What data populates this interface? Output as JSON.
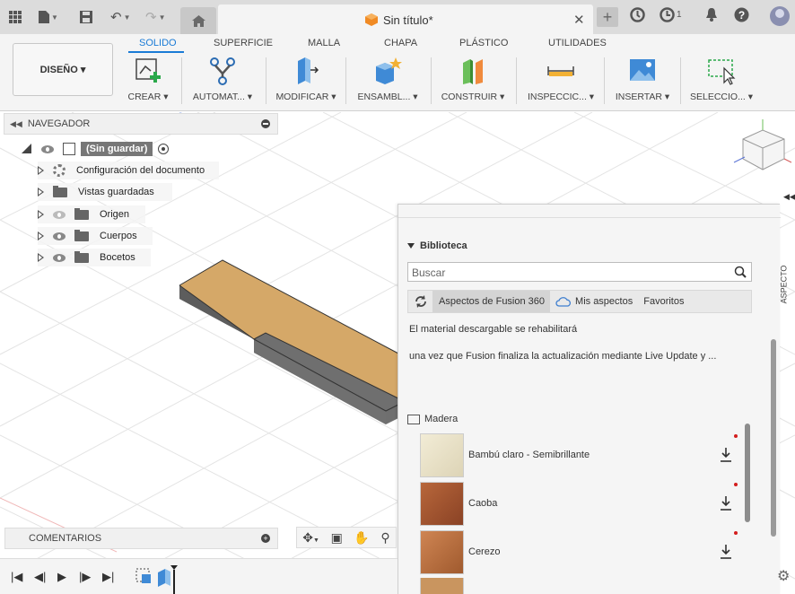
{
  "titlebar": {
    "doc_title": "Sin título*",
    "jobs_count": "1"
  },
  "ribbon": {
    "workspace": "DISEÑO ▾",
    "tabs": [
      {
        "label": "SOLIDO",
        "active": true
      },
      {
        "label": "SUPERFICIE"
      },
      {
        "label": "MALLA"
      },
      {
        "label": "CHAPA"
      },
      {
        "label": "PLÁSTICO"
      },
      {
        "label": "UTILIDADES"
      }
    ],
    "groups": [
      {
        "label": "CREAR ▾",
        "icon": "create-sketch-icon"
      },
      {
        "label": "AUTOMAT... ▾",
        "icon": "automate-icon"
      },
      {
        "label": "MODIFICAR ▾",
        "icon": "modify-icon"
      },
      {
        "label": "ENSAMBL... ▾",
        "icon": "assemble-icon"
      },
      {
        "label": "CONSTRUIR ▾",
        "icon": "construct-icon"
      },
      {
        "label": "INSPECCIC... ▾",
        "icon": "inspect-icon"
      },
      {
        "label": "INSERTAR ▾",
        "icon": "insert-image-icon"
      },
      {
        "label": "SELECCIO... ▾",
        "icon": "select-icon"
      }
    ]
  },
  "navigator": {
    "title": "NAVEGADOR",
    "root": "(Sin guardar)",
    "items": [
      {
        "label": "Configuración del documento",
        "icon": "gear-icon"
      },
      {
        "label": "Vistas guardadas",
        "icon": "folder-icon"
      },
      {
        "label": "Origen",
        "icon": "folder-icon"
      },
      {
        "label": "Cuerpos",
        "icon": "folder-icon"
      },
      {
        "label": "Bocetos",
        "icon": "folder-icon"
      }
    ]
  },
  "panel": {
    "section": "Biblioteca",
    "search_placeholder": "Buscar",
    "tabs": [
      "Aspectos de Fusion 360",
      "Mis aspectos",
      "Favoritos"
    ],
    "notice_line1": "El material descargable se rehabilitará",
    "notice_line2": "una vez que Fusion finaliza la actualización mediante Live Update y ...",
    "category": "Madera",
    "materials": [
      {
        "name": "Bambú claro - Semibrillante",
        "color": "#e9e2c8"
      },
      {
        "name": "Caoba",
        "color": "#a2552f"
      },
      {
        "name": "Cerezo",
        "color": "#b96d3e"
      }
    ],
    "side_tab": "ASPECTO"
  },
  "comments": {
    "title": "COMENTARIOS"
  },
  "colors": {
    "accent": "#1a7bd6",
    "body_top": "#d5a868",
    "body_side": "#6f6f6f"
  }
}
